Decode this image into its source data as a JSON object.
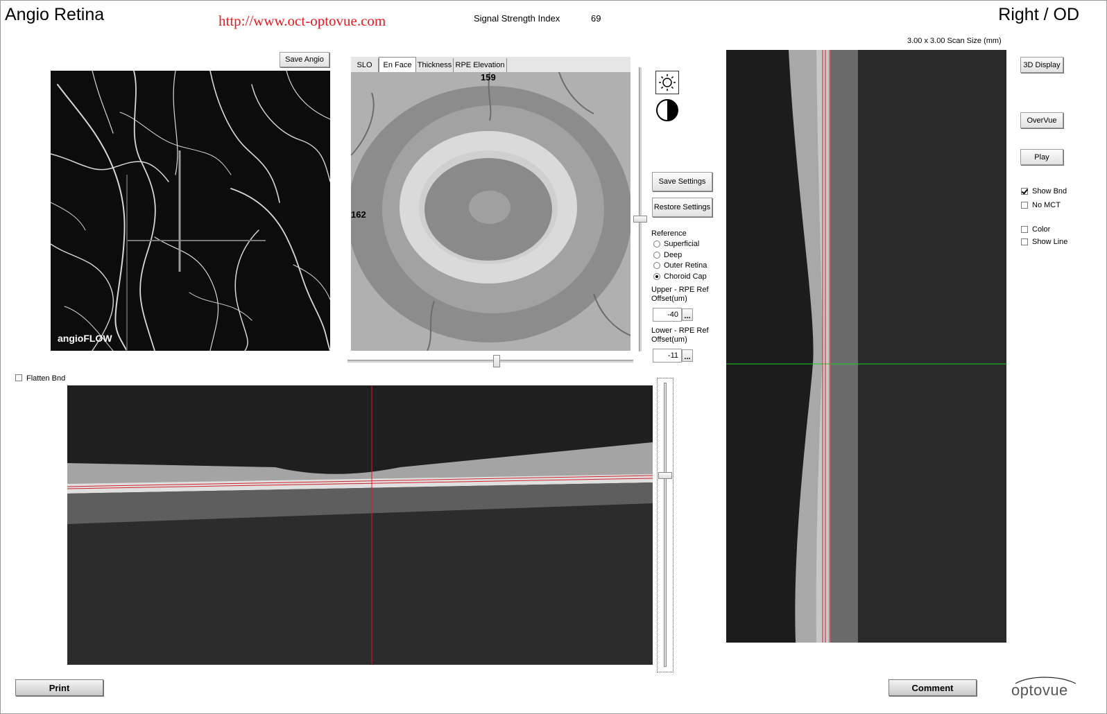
{
  "header": {
    "app_title": "Angio Retina",
    "url": "http://www.oct-optovue.com",
    "signal_label": "Signal Strength Index",
    "signal_value": "69",
    "eye": "Right / OD",
    "scan_size": "3.00 x 3.00 Scan Size (mm)"
  },
  "angio": {
    "save_label": "Save Angio",
    "logo_text": "angioFLOW"
  },
  "enface": {
    "tabs": [
      "SLO",
      "En Face",
      "Thickness",
      "RPE Elevation"
    ],
    "active_tab": "En Face",
    "marker_top": "159",
    "marker_left": "162"
  },
  "controls": {
    "brightness_icon": "sun-icon",
    "contrast_icon": "contrast-icon",
    "save_settings": "Save Settings",
    "restore_settings": "Restore Settings",
    "reference_label": "Reference",
    "reference_options": [
      "Superficial",
      "Deep",
      "Outer Retina",
      "Choroid Cap"
    ],
    "reference_selected": "Choroid Cap",
    "upper_label_1": "Upper - RPE Ref",
    "upper_label_2": "Offset(um)",
    "upper_value": "-40",
    "lower_label_1": "Lower - RPE Ref",
    "lower_label_2": "Offset(um)",
    "lower_value": "-11",
    "browse_label": "..."
  },
  "right_panel": {
    "btn_3d": "3D Display",
    "btn_overvue": "OverVue",
    "btn_play": "Play",
    "show_bnd": "Show Bnd",
    "show_bnd_checked": true,
    "no_mct": "No MCT",
    "no_mct_checked": false,
    "color": "Color",
    "color_checked": false,
    "show_line": "Show Line",
    "show_line_checked": false
  },
  "bscan": {
    "flatten_label": "Flatten Bnd",
    "flatten_checked": false
  },
  "footer": {
    "print": "Print",
    "comment": "Comment",
    "logo": "optovue"
  },
  "colors": {
    "url_red": "#e8191e",
    "boundary_red": "#d0202a",
    "crosshair_green": "#1fd01f",
    "logo_blue": "#2a7ec8"
  }
}
